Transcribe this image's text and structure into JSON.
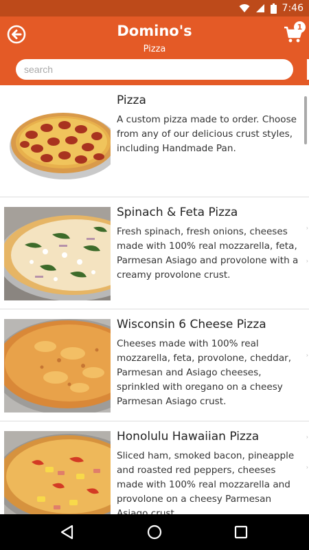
{
  "status_bar": {
    "time": "7:46",
    "icons": [
      "wifi-icon",
      "signal-icon",
      "battery-icon"
    ]
  },
  "header": {
    "title": "Domino's",
    "subtitle": "Pizza",
    "back_icon": "back-arrow-icon",
    "cart_icon": "shopping-cart-icon",
    "cart_count": "1",
    "search_placeholder": "search",
    "search_value": ""
  },
  "colors": {
    "header": "#e45a26",
    "status_bar": "#bd4a1a",
    "navigation_bar": "#000000"
  },
  "menu_items": [
    {
      "name": "Pizza",
      "description": "A custom pizza made to order. Choose from any of our delicious crust styles, including Handmade Pan.",
      "image": "pepperoni-pizza"
    },
    {
      "name": "Spinach & Feta Pizza",
      "description": "Fresh spinach, fresh onions, cheeses made with 100% real mozzarella, feta, Parmesan Asiago and provolone with a creamy provolone crust.",
      "image": "spinach-feta-pizza"
    },
    {
      "name": "Wisconsin 6 Cheese Pizza",
      "description": "Cheeses made with 100% real mozzarella, feta, provolone, cheddar, Parmesan and Asiago cheeses, sprinkled with oregano on a cheesy Parmesan Asiago crust.",
      "image": "six-cheese-pizza"
    },
    {
      "name": "Honolulu Hawaiian Pizza",
      "description": "Sliced ham, smoked bacon, pineapple and roasted red peppers, cheeses made with 100% real mozzarella and provolone on a cheesy Parmesan Asiago crust.",
      "image": "hawaiian-pizza"
    }
  ],
  "navigation": {
    "buttons": [
      "back-triangle-icon",
      "home-circle-icon",
      "recents-square-icon"
    ]
  }
}
